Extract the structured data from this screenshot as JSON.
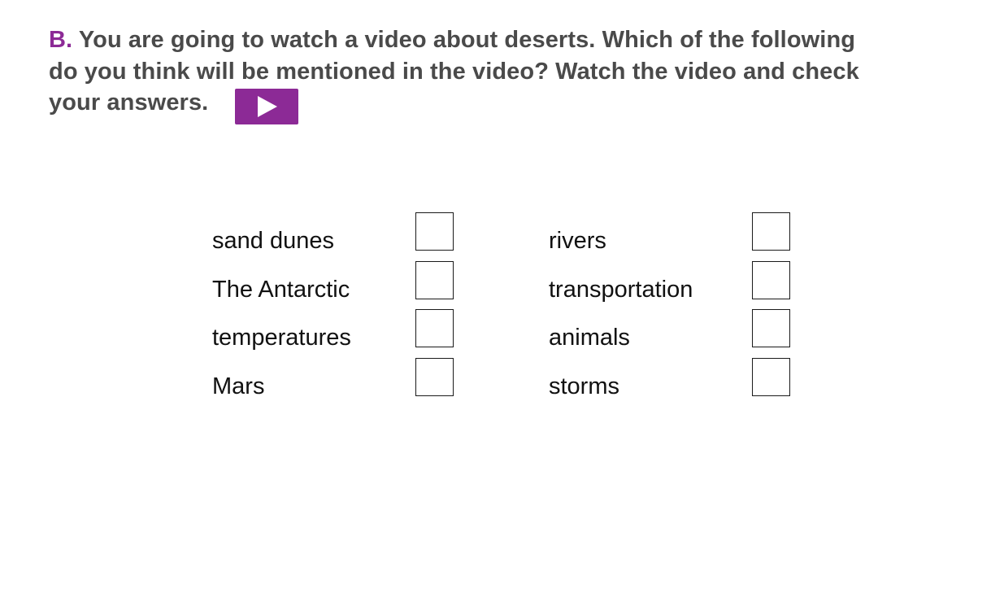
{
  "exercise": {
    "section_letter": "B.",
    "instruction_line1": "You are going to watch a video about deserts. Which of the following",
    "instruction_line2": "do you think will be mentioned in the video? Watch the video and check",
    "instruction_line3": "your answers.",
    "play_button_icon": "play-icon",
    "accent_color": "#8c2a96",
    "text_color": "#4a4a4a"
  },
  "items": {
    "left": [
      {
        "label": "sand dunes",
        "checked": false
      },
      {
        "label": "The Antarctic",
        "checked": false
      },
      {
        "label": "temperatures",
        "checked": false
      },
      {
        "label": "Mars",
        "checked": false
      }
    ],
    "right": [
      {
        "label": "rivers",
        "checked": false
      },
      {
        "label": "transportation",
        "checked": false
      },
      {
        "label": "animals",
        "checked": false
      },
      {
        "label": "storms",
        "checked": false
      }
    ]
  }
}
